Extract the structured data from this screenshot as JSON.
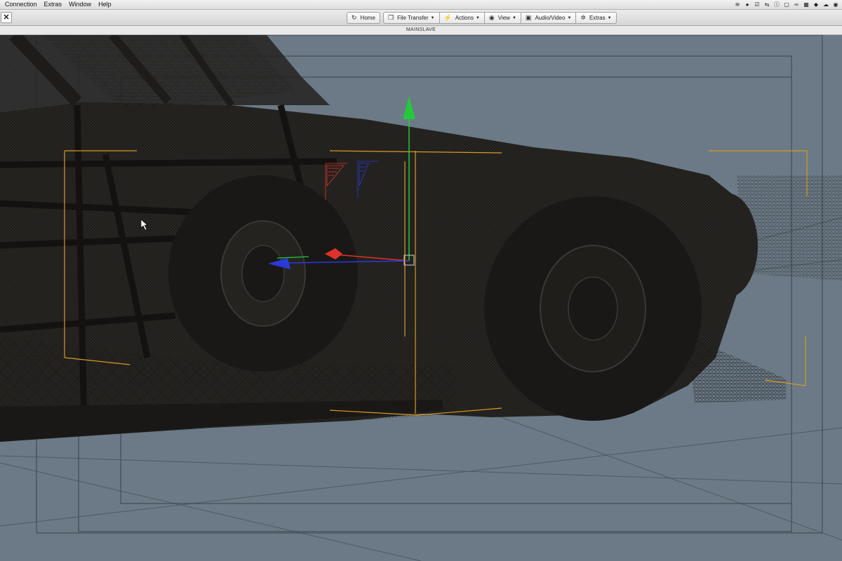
{
  "menubar": {
    "items": [
      "Connection",
      "Extras",
      "Window",
      "Help"
    ]
  },
  "toolbar": {
    "home_label": "Home",
    "file_transfer_label": "File Transfer",
    "actions_label": "Actions",
    "view_label": "View",
    "audio_video_label": "Audio/Video",
    "extras_label": "Extras"
  },
  "session": {
    "title": "MAINSLAVE"
  },
  "viewport": {
    "background_color": "#6b7a86",
    "mesh_color": "#1e1c1a",
    "gizmo": {
      "y_axis_color": "#22c93a",
      "x_axis_color": "#e0322a",
      "z_axis_color": "#2b3ad8"
    },
    "bbox_color": "#d89a22"
  }
}
